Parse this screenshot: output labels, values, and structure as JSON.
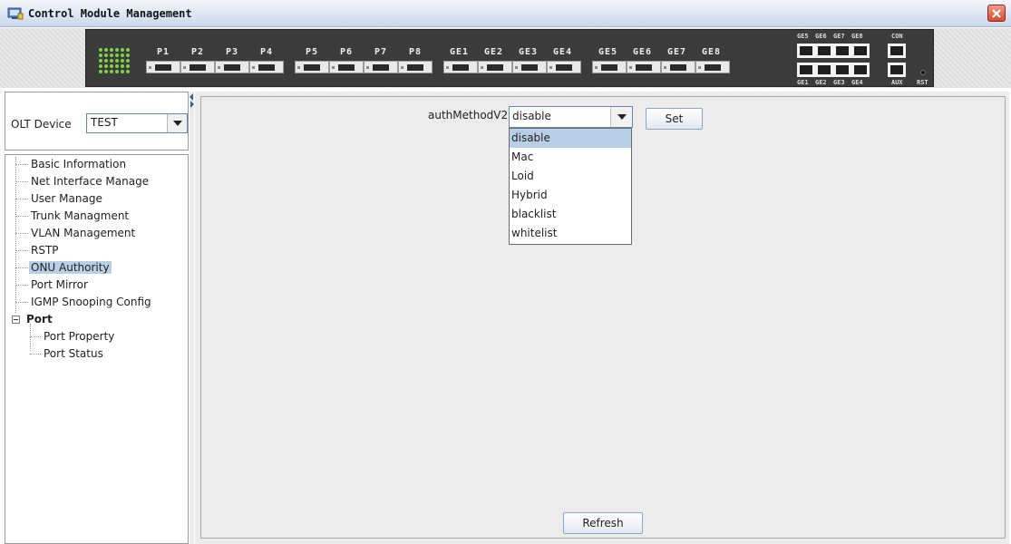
{
  "window": {
    "title": "Control Module Management",
    "close_icon": "close-icon"
  },
  "device_panel": {
    "port_labels": [
      "P1",
      "P2",
      "P3",
      "P4",
      "P5",
      "P6",
      "P7",
      "P8",
      "GE1",
      "GE2",
      "GE3",
      "GE4",
      "GE5",
      "GE6",
      "GE7",
      "GE8"
    ],
    "upper_rj45_labels": [
      "GE5",
      "GE6",
      "GE7",
      "GE8"
    ],
    "lower_rj45_labels": [
      "GE1",
      "GE2",
      "GE3",
      "GE4"
    ],
    "con_label": "CON",
    "aux_label": "AUX",
    "rst_label": "RST",
    "led_color": "#7fd04a"
  },
  "olt": {
    "label": "OLT Device",
    "selected": "TEST"
  },
  "tree": {
    "items": [
      {
        "label": "Basic Information"
      },
      {
        "label": "Net Interface Manage"
      },
      {
        "label": "User Manage"
      },
      {
        "label": "Trunk Managment"
      },
      {
        "label": "VLAN Management"
      },
      {
        "label": "RSTP"
      },
      {
        "label": "ONU Authority",
        "selected": true
      },
      {
        "label": "Port Mirror"
      },
      {
        "label": "IGMP Snooping Config"
      },
      {
        "label": "Port",
        "expanded": true
      },
      {
        "label": "Port Property"
      },
      {
        "label": "Port Status"
      }
    ]
  },
  "main": {
    "auth_label": "authMethodV2",
    "auth_selected": "disable",
    "auth_options": [
      "disable",
      "Mac",
      "Loid",
      "Hybrid",
      "blacklist",
      "whitelist"
    ],
    "set_label": "Set",
    "refresh_label": "Refresh"
  },
  "colors": {
    "selection": "#b8cfe6",
    "titlebar": "#dbe5f3",
    "panel": "#3b3b3b",
    "close": "#d64a30"
  }
}
